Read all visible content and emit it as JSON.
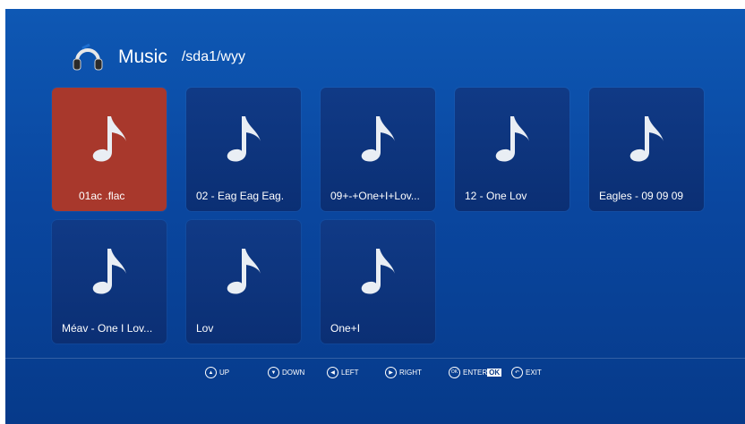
{
  "header": {
    "icon": "headphones-icon",
    "title": "Music",
    "path": "/sda1/wyy"
  },
  "files": [
    {
      "label": "01ac  .flac",
      "selected": true
    },
    {
      "label": "02 -  Eag Eag Eag.",
      "selected": false
    },
    {
      "label": "09+-+One+I+Lov...",
      "selected": false
    },
    {
      "label": "12 - One Lov",
      "selected": false
    },
    {
      "label": "Eagles - 09 09 09",
      "selected": false
    },
    {
      "label": "Méav - One I Lov...",
      "selected": false
    },
    {
      "label": "Lov",
      "selected": false
    },
    {
      "label": "One+I",
      "selected": false
    }
  ],
  "footer": {
    "up": "UP",
    "down": "DOWN",
    "left": "LEFT",
    "right": "RIGHT",
    "enter_icon": "OK",
    "enter": "ENTER",
    "enter_ok": "OK",
    "exit": "EXIT"
  },
  "colors": {
    "background": "#0a47a0",
    "tile": "#0f3781",
    "selected_tile": "#a8382c"
  }
}
